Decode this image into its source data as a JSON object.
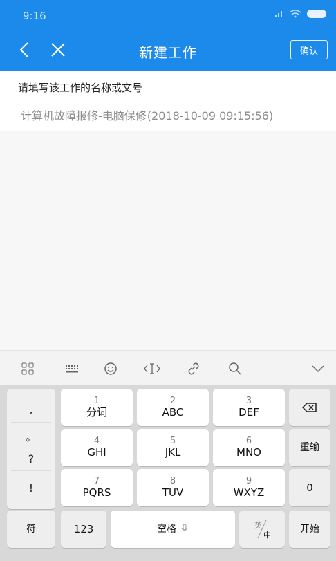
{
  "status_bar": {
    "time": "9:16"
  },
  "header": {
    "title": "新建工作",
    "confirm_label": "确认"
  },
  "form": {
    "prompt": "请填写该工作的名称或文号",
    "value_before_cursor": "计算机故障报修-电脑保修",
    "value_after_cursor": "(2018-10-09 09:15:56)"
  },
  "keyboard": {
    "punctuation": [
      ",",
      "。",
      "?",
      "!"
    ],
    "keys": [
      {
        "num": "1",
        "label": "分词"
      },
      {
        "num": "2",
        "label": "ABC"
      },
      {
        "num": "3",
        "label": "DEF"
      },
      {
        "num": "4",
        "label": "GHI"
      },
      {
        "num": "5",
        "label": "JKL"
      },
      {
        "num": "6",
        "label": "MNO"
      },
      {
        "num": "7",
        "label": "PQRS"
      },
      {
        "num": "8",
        "label": "TUV"
      },
      {
        "num": "9",
        "label": "WXYZ"
      }
    ],
    "reenter_label": "重输",
    "zero_label": "0",
    "symbol_label": "符",
    "num_label": "123",
    "space_label": "空格",
    "lang_top": "英",
    "lang_bottom": "中",
    "start_label": "开始"
  }
}
